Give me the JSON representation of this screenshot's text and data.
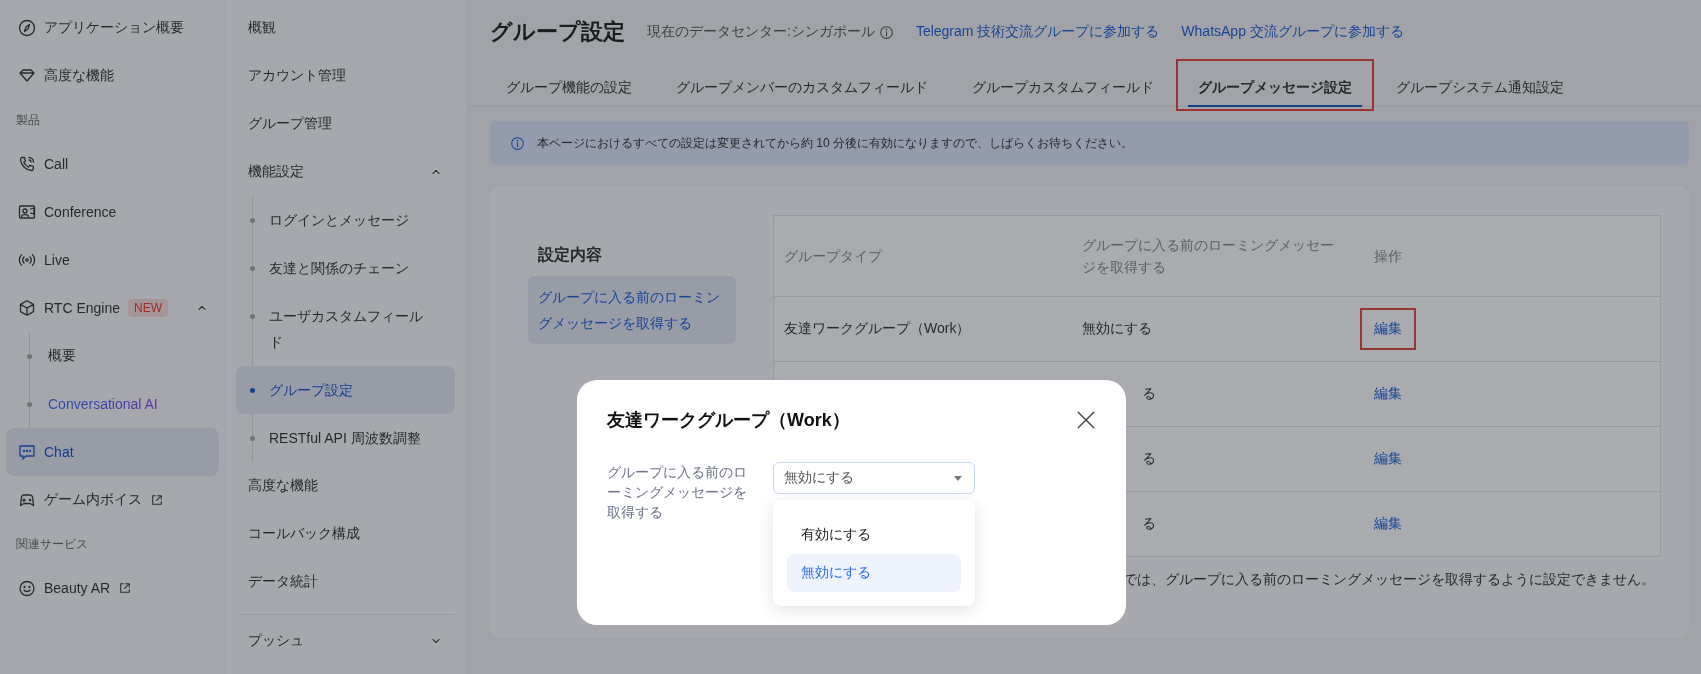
{
  "nav": {
    "items": [
      {
        "kind": "item",
        "label": "アプリケーション概要",
        "selected": false
      },
      {
        "kind": "item",
        "label": "高度な機能",
        "selected": false
      },
      {
        "kind": "section",
        "label": "製品"
      },
      {
        "kind": "item",
        "label": "Call",
        "selected": false
      },
      {
        "kind": "item",
        "label": "Conference",
        "selected": false
      },
      {
        "kind": "item",
        "label": "Live",
        "selected": false
      },
      {
        "kind": "item",
        "label": "RTC Engine",
        "badge": "NEW",
        "expanded": true,
        "selected": false,
        "children": [
          {
            "label": "概要",
            "accent": false
          },
          {
            "label": "Conversational AI",
            "accent": true
          }
        ]
      },
      {
        "kind": "item",
        "label": "Chat",
        "selected": true
      },
      {
        "kind": "item",
        "label": "ゲーム内ボイス",
        "external": true,
        "selected": false
      },
      {
        "kind": "section",
        "label": "関連サービス"
      },
      {
        "kind": "item",
        "label": "Beauty AR",
        "external": true,
        "selected": false
      }
    ]
  },
  "subnav": {
    "items": [
      {
        "kind": "item",
        "label": "概観",
        "selected": false
      },
      {
        "kind": "item",
        "label": "アカウント管理",
        "selected": false
      },
      {
        "kind": "item",
        "label": "グループ管理",
        "selected": false
      },
      {
        "kind": "item",
        "label": "機能設定",
        "expanded": true,
        "selected": false,
        "children": [
          {
            "label": "ログインとメッセージ",
            "selected": false
          },
          {
            "label": "友達と関係のチェーン",
            "selected": false
          },
          {
            "label": "ユーザカスタムフィールド",
            "selected": false
          },
          {
            "label": "グループ設定",
            "selected": true
          },
          {
            "label": "RESTful API 周波数調整",
            "selected": false
          }
        ]
      },
      {
        "kind": "item",
        "label": "高度な機能",
        "selected": false
      },
      {
        "kind": "item",
        "label": "コールバック構成",
        "selected": false
      },
      {
        "kind": "item",
        "label": "データ統計",
        "selected": false
      },
      {
        "kind": "divider"
      },
      {
        "kind": "item",
        "label": "プッシュ",
        "expanded": false,
        "selected": false
      }
    ]
  },
  "header": {
    "title": "グループ設定",
    "datacenter": "現在のデータセンター:シンガポール",
    "links": [
      "Telegram 技術交流グループに参加する",
      "WhatsApp 交流グループに参加する"
    ]
  },
  "tabs": [
    {
      "label": "グループ機能の設定",
      "selected": false,
      "highlighted": false
    },
    {
      "label": "グループメンバーのカスタムフィールド",
      "selected": false,
      "highlighted": false
    },
    {
      "label": "グループカスタムフィールド",
      "selected": false,
      "highlighted": false
    },
    {
      "label": "グループメッセージ設定",
      "selected": true,
      "highlighted": true
    },
    {
      "label": "グループシステム通知設定",
      "selected": false,
      "highlighted": false
    }
  ],
  "banner": "本ページにおけるすべての設定は変更されてから約 10 分後に有効になりますので、しばらくお待ちください。",
  "settings": {
    "title": "設定内容",
    "items": [
      {
        "label": "グループに入る前のローミングメッセージを取得する",
        "selected": true
      }
    ]
  },
  "table": {
    "columns": [
      "グループタイプ",
      "グループに入る前のローミングメッセージを取得する",
      "操作"
    ],
    "rows": [
      {
        "group_type": "友達ワークグループ（Work）",
        "value": "無効にする",
        "action": "編集",
        "highlighted": true
      },
      {
        "value": "る",
        "action": "編集",
        "highlighted": false
      },
      {
        "value": "る",
        "action": "編集",
        "highlighted": false
      },
      {
        "value": "る",
        "action": "編集",
        "highlighted": false
      }
    ]
  },
  "note": "では、グループに入る前のローミングメッセージを取得するように設定できません。",
  "modal": {
    "title": "友達ワークグループ（Work）",
    "field_label": "グループに入る前のローミングメッセージを取得する",
    "select": {
      "value": "無効にする",
      "open": true,
      "options": [
        {
          "label": "有効にする",
          "selected": false
        },
        {
          "label": "無効にする",
          "selected": true
        }
      ]
    }
  }
}
